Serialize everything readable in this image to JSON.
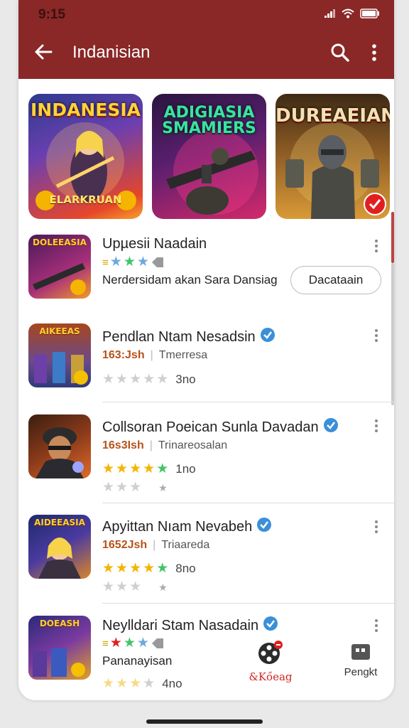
{
  "status": {
    "time": "9:15"
  },
  "appbar": {
    "title": "Indanisian"
  },
  "banners": [
    {
      "title": "INDANESIA",
      "subtitle": "ELARKRUAN",
      "colors": [
        "#2d3b8f",
        "#e6462a"
      ]
    },
    {
      "title": "ADIGIASIA\nSMAMIERS",
      "colors": [
        "#3a1d52",
        "#d4296a"
      ]
    },
    {
      "title": "DUREAEIAN",
      "colors": [
        "#6b3a14",
        "#d99a37"
      ]
    }
  ],
  "featured": {
    "thumb_label": "DOLEEASIA",
    "title": "Upµesii Naadain",
    "description": "Nerdersidam akan Sara Dansiag",
    "button": "Dacataain"
  },
  "apps": [
    {
      "thumb_label": "AIKEEAS",
      "title": "Pendlan Ntam Nesadsin",
      "price": "163:Jsh",
      "category": "Tmerresa",
      "rating": 0,
      "count": "3no"
    },
    {
      "thumb_label": "",
      "title": "Collsoran Poeican Sunla Davadan",
      "price": "16s3Ish",
      "category": "Trinareosalan",
      "rating": 5,
      "count": "1no"
    },
    {
      "thumb_label": "AIDEEASIA",
      "title": "Apyittan Nıam Nevabeh",
      "price": "1652Jsh",
      "category": "Triaareda",
      "rating": 5,
      "count": "8no"
    },
    {
      "thumb_label": "DOEASH",
      "title": "Neylldari Stam Nasadain",
      "sub": "Pananayisan",
      "count": "4no"
    }
  ],
  "bottom_nav": [
    {
      "label": "&Kőeag",
      "icon": "film-reel-icon"
    },
    {
      "label": "Pengkt",
      "icon": "tablet-icon"
    }
  ],
  "colors": {
    "appbar": "#8a2727",
    "verified": "#3b8fd9",
    "star_gold": "#f5b400",
    "star_green": "#44c46a"
  }
}
